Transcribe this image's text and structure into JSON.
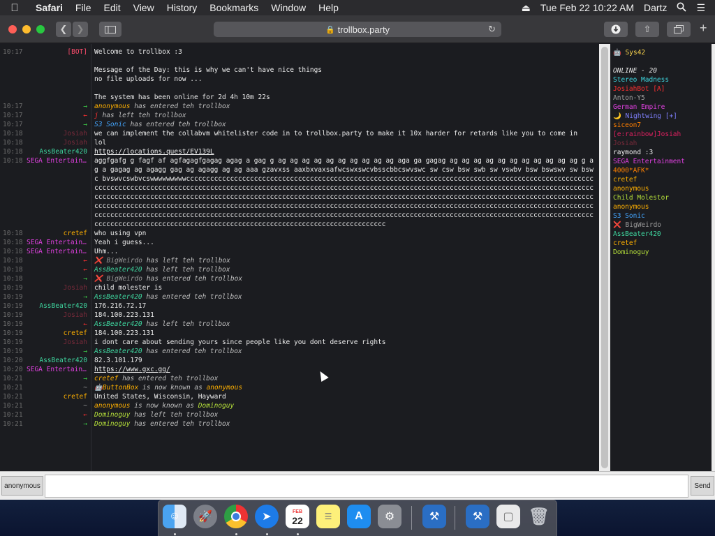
{
  "menubar": {
    "app": "Safari",
    "items": [
      "File",
      "Edit",
      "View",
      "History",
      "Bookmarks",
      "Window",
      "Help"
    ],
    "datetime": "Tue Feb 22  10:22 AM",
    "user": "Dartz"
  },
  "browser": {
    "url": "trollbox.party"
  },
  "chat": {
    "messages": [
      {
        "time": "10:17",
        "nick": "[BOT]",
        "nick_color": "#ff4d6d",
        "text": "Welcome to trollbox :3",
        "type": "msg"
      },
      {
        "time": "",
        "nick": "",
        "nick_color": "",
        "text": "",
        "type": "blank"
      },
      {
        "time": "",
        "nick": "",
        "nick_color": "",
        "text": "Message of the Day: this is why we can't have nice things",
        "type": "msg"
      },
      {
        "time": "",
        "nick": "",
        "nick_color": "",
        "text": "no file uploads for now ...",
        "type": "msg"
      },
      {
        "time": "",
        "nick": "",
        "nick_color": "",
        "text": "",
        "type": "blank"
      },
      {
        "time": "",
        "nick": "",
        "nick_color": "",
        "text": "The system has been online for 2d 4h 10m 22s",
        "type": "msg"
      },
      {
        "time": "10:17",
        "nick": "→",
        "nick_color": "#3fd84a",
        "user": "anonymous",
        "user_color": "#ffb000",
        "text": "has entered teh trollbox",
        "type": "sys"
      },
      {
        "time": "10:17",
        "nick": "←",
        "nick_color": "#ff3030",
        "user": "j",
        "user_color": "#ff3030",
        "text": "has left teh trollbox",
        "type": "sys"
      },
      {
        "time": "10:17",
        "nick": "→",
        "nick_color": "#3fd84a",
        "user": "S3 Sonic",
        "user_color": "#44a6ff",
        "text": "has entered teh trollbox",
        "type": "sys"
      },
      {
        "time": "10:18",
        "nick": "Josiah",
        "nick_color": "#7a2a3a",
        "text": "we can implement the collabvm whitelister code in to trollbox.party to make it 10x harder for retards like you to come in",
        "type": "wrap"
      },
      {
        "time": "",
        "nick": "",
        "nick_color": "",
        "text": "",
        "type": "spacer"
      },
      {
        "time": "10:18",
        "nick": "Josiah",
        "nick_color": "#7a2a3a",
        "text": "lol",
        "type": "msg"
      },
      {
        "time": "10:18",
        "nick": "AssBeater420",
        "nick_color": "#3fd8a0",
        "text": "https://locations.quest/EV139L",
        "type": "link"
      },
      {
        "time": "10:18",
        "nick": "SEGA Entertainment",
        "nick_color": "#e040e0",
        "text": "aggfgafg g fagf af agfagagfgagag agag a gag g ag ag ag ag ag ag ag ag ag ag aga ga gagag ag ag ag ag ag ag ag ag ag ag ag g ag a gagag ag agagg   gag ag agagg ag ag aaa gzavxss aaxbxvaxsafwcswxswcvbsscbbcswvswc sw csw bsw swb sw vswbv  bsw bswswv sw bswc bvswvcswbvcswwwwwwwwwccccccccccccccccccccccccccccccccccccccccccccccccccccccccccccccccccccccccccccccccccccccccccccccccccccccccccccccccccccccccccccccccccccccccccccccccccccccccccccccccccccccccccccccccccccccccccccccccccccccccccccccccccccccccccccccccccccccccccccccccccccccccccccccccccccccccccccccccccccccccccccccccccccccccccccccccccccccccccccccccccccccccccccccccccccccccccccccccccccccccccccccccccccccccccccccccccccccccccccccccccccccccccccccccccccccccccccccccccccccccccccccccccccccccccccccccccccccccccccccccccccccccccccccccccccccccccccccccccccccccccccccccccccccccccccccccccccccccccccccccccccccccccccccccccccccccccccccccccccccccccccccccccccccccccccccccccccccccccccccccccccccccccccccccccccccccccccccccccc",
        "type": "wrap"
      },
      {
        "time": "10:18",
        "nick": "cretef",
        "nick_color": "#ffb000",
        "text": "who using vpn",
        "type": "msg"
      },
      {
        "time": "10:18",
        "nick": "SEGA Entertainment",
        "nick_color": "#e040e0",
        "text": "Yeah i guess...",
        "type": "msg"
      },
      {
        "time": "10:18",
        "nick": "SEGA Entertainment",
        "nick_color": "#e040e0",
        "text": "Uhm...",
        "type": "msg"
      },
      {
        "time": "10:18",
        "nick": "←",
        "nick_color": "#ff3030",
        "user": "❌ BigWeirdo",
        "user_color": "#999999",
        "text": "has left teh trollbox",
        "type": "sys"
      },
      {
        "time": "10:18",
        "nick": "←",
        "nick_color": "#ff3030",
        "user": "AssBeater420",
        "user_color": "#3fd8a0",
        "text": "has left teh trollbox",
        "type": "sys"
      },
      {
        "time": "10:18",
        "nick": "→",
        "nick_color": "#3fd84a",
        "user": "❌ BigWeirdo",
        "user_color": "#999999",
        "text": "has entered teh trollbox",
        "type": "sys"
      },
      {
        "time": "10:19",
        "nick": "Josiah",
        "nick_color": "#7a2a3a",
        "text": "child molester is",
        "type": "msg"
      },
      {
        "time": "10:19",
        "nick": "→",
        "nick_color": "#3fd84a",
        "user": "AssBeater420",
        "user_color": "#3fd8a0",
        "text": "has entered teh trollbox",
        "type": "sys"
      },
      {
        "time": "10:19",
        "nick": "AssBeater420",
        "nick_color": "#3fd8a0",
        "text": "176.216.72.17",
        "type": "msg"
      },
      {
        "time": "10:19",
        "nick": "Josiah",
        "nick_color": "#7a2a3a",
        "text": "184.100.223.131",
        "type": "msg"
      },
      {
        "time": "10:19",
        "nick": "←",
        "nick_color": "#ff3030",
        "user": "AssBeater420",
        "user_color": "#3fd8a0",
        "text": "has left teh trollbox",
        "type": "sys"
      },
      {
        "time": "10:19",
        "nick": "cretef",
        "nick_color": "#ffb000",
        "text": "184.100.223.131",
        "type": "msg"
      },
      {
        "time": "10:19",
        "nick": "Josiah",
        "nick_color": "#7a2a3a",
        "text": "i dont care about sending yours since people like you dont deserve rights",
        "type": "msg"
      },
      {
        "time": "10:19",
        "nick": "→",
        "nick_color": "#3fd84a",
        "user": "AssBeater420",
        "user_color": "#3fd8a0",
        "text": "has entered teh trollbox",
        "type": "sys"
      },
      {
        "time": "10:20",
        "nick": "AssBeater420",
        "nick_color": "#3fd8a0",
        "text": "82.3.101.179",
        "type": "msg"
      },
      {
        "time": "10:20",
        "nick": "SEGA Entertainment",
        "nick_color": "#e040e0",
        "text": "https://www.gxc.gg/",
        "type": "link"
      },
      {
        "time": "10:21",
        "nick": "→",
        "nick_color": "#3fd84a",
        "user": "cretef",
        "user_color": "#ffb000",
        "text": "has entered teh trollbox",
        "type": "sys"
      },
      {
        "time": "10:21",
        "nick": "~",
        "nick_color": "#999999",
        "user": "🤖ButtonBox",
        "user_color": "#ffb000",
        "text": "is now known as",
        "user2": "anonymous",
        "user2_color": "#ffb000",
        "type": "rename"
      },
      {
        "time": "10:21",
        "nick": "cretef",
        "nick_color": "#ffb000",
        "text": "United States, Wisconsin, Hayward",
        "type": "msg"
      },
      {
        "time": "10:21",
        "nick": "~",
        "nick_color": "#999999",
        "user": "anonymous",
        "user_color": "#ffb000",
        "text": "is now known as",
        "user2": "Dominoguy",
        "user2_color": "#b6e03a",
        "type": "rename"
      },
      {
        "time": "10:21",
        "nick": "←",
        "nick_color": "#ff3030",
        "user": "Dominoguy",
        "user_color": "#b6e03a",
        "text": "has left teh trollbox",
        "type": "sys"
      },
      {
        "time": "10:21",
        "nick": "→",
        "nick_color": "#3fd84a",
        "user": "Dominoguy",
        "user_color": "#b6e03a",
        "text": "has entered teh trollbox",
        "type": "sys"
      }
    ]
  },
  "userlist": {
    "room": "🤖 Sys42",
    "room_color": "#ffd84d",
    "online_label": "ONLINE - 20",
    "users": [
      {
        "name": "Stereo Madness",
        "color": "#3fd8e0"
      },
      {
        "name": "JosiahBot [A]",
        "color": "#ff3030"
      },
      {
        "name": "Anton-Y5",
        "color": "#a0a0a0"
      },
      {
        "name": "German Empire",
        "color": "#e040e0"
      },
      {
        "name": "🌙 Nightwing [+]",
        "color": "#8080ff"
      },
      {
        "name": "siceon7",
        "color": "#ff7f00"
      },
      {
        "name": "[e:rainbow]Josiah",
        "color": "#e02060"
      },
      {
        "name": "Josiah",
        "color": "#7a2a3a"
      },
      {
        "name": "raymond :3",
        "color": "#f2f2f2"
      },
      {
        "name": "SEGA Entertainment",
        "color": "#e040e0"
      },
      {
        "name": "4000*AFK*",
        "color": "#ff8000"
      },
      {
        "name": "cretef",
        "color": "#ffb000"
      },
      {
        "name": "anonymous",
        "color": "#ffb000"
      },
      {
        "name": "Child Molestor",
        "color": "#b6e03a"
      },
      {
        "name": "anonymous",
        "color": "#ffb000"
      },
      {
        "name": "S3 Sonic",
        "color": "#44a6ff"
      },
      {
        "name": "❌ BigWeirdo",
        "color": "#999999"
      },
      {
        "name": "AssBeater420",
        "color": "#3fd8a0"
      },
      {
        "name": "cretef",
        "color": "#ffb000"
      },
      {
        "name": "Dominoguy",
        "color": "#b6e03a"
      }
    ]
  },
  "input": {
    "nick_label": "anonymous",
    "message_value": "",
    "send_label": "Send"
  },
  "dock": {
    "calendar_month": "FEB",
    "calendar_day": "22",
    "apps": [
      "finder-icon",
      "launchpad-icon",
      "chrome-icon",
      "safari-icon",
      "calendar-icon",
      "notes-icon",
      "app-store-icon",
      "system-preferences-icon",
      "xcode-instruments-icon",
      "document-icon",
      "trash-icon"
    ]
  }
}
